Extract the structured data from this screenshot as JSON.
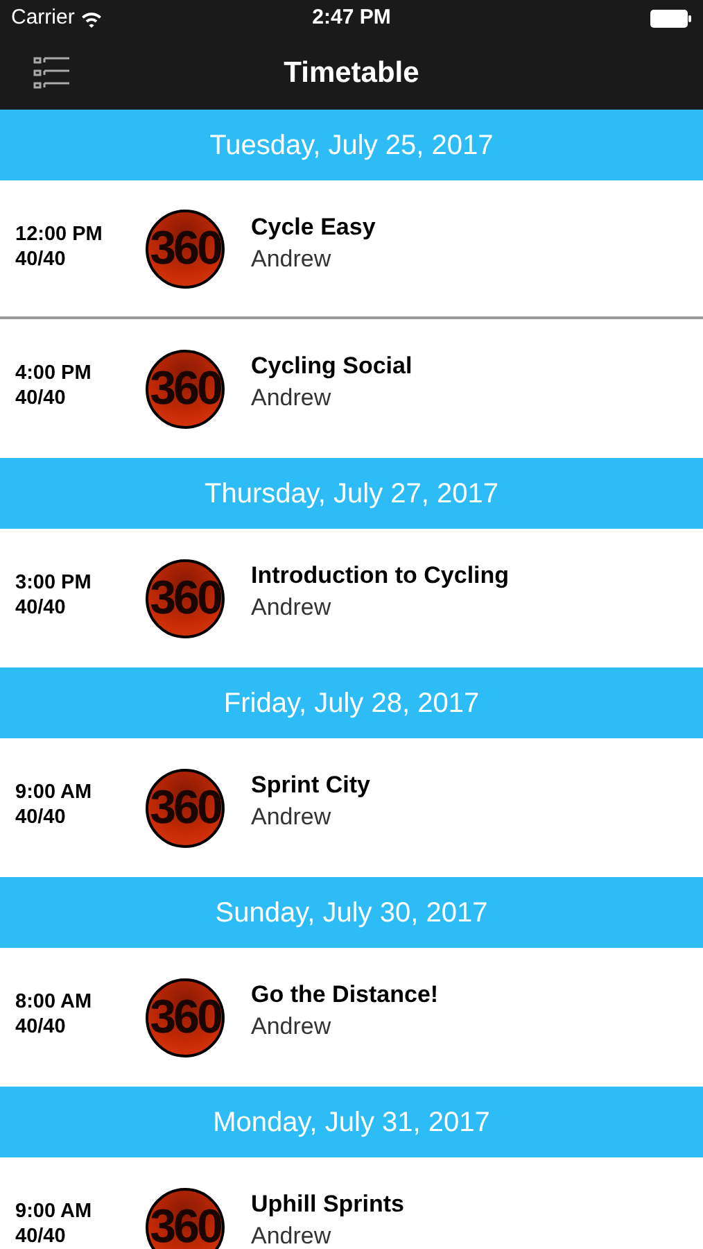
{
  "status_bar": {
    "carrier": "Carrier",
    "time": "2:47 PM"
  },
  "nav": {
    "title": "Timetable"
  },
  "sections": [
    {
      "date": "Tuesday, July 25, 2017",
      "classes": [
        {
          "time": "12:00 PM",
          "spots": "40/40",
          "logo": "360",
          "name": "Cycle Easy",
          "instructor": "Andrew"
        },
        {
          "time": "4:00 PM",
          "spots": "40/40",
          "logo": "360",
          "name": "Cycling Social",
          "instructor": "Andrew"
        }
      ]
    },
    {
      "date": "Thursday, July 27, 2017",
      "classes": [
        {
          "time": "3:00 PM",
          "spots": "40/40",
          "logo": "360",
          "name": "Introduction to Cycling",
          "instructor": "Andrew"
        }
      ]
    },
    {
      "date": "Friday, July 28, 2017",
      "classes": [
        {
          "time": "9:00 AM",
          "spots": "40/40",
          "logo": "360",
          "name": "Sprint City",
          "instructor": "Andrew"
        }
      ]
    },
    {
      "date": "Sunday, July 30, 2017",
      "classes": [
        {
          "time": "8:00 AM",
          "spots": "40/40",
          "logo": "360",
          "name": "Go the Distance!",
          "instructor": "Andrew"
        }
      ]
    },
    {
      "date": "Monday, July 31, 2017",
      "classes": [
        {
          "time": "9:00 AM",
          "spots": "40/40",
          "logo": "360",
          "name": "Uphill Sprints",
          "instructor": "Andrew"
        }
      ]
    }
  ]
}
